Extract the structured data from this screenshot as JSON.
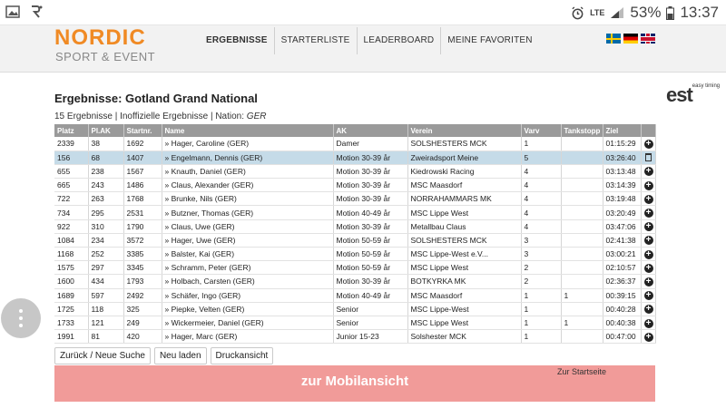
{
  "status_bar": {
    "signal_label": "LTE",
    "battery": "53%",
    "clock": "13:37"
  },
  "site": {
    "logo_main": "NORDIC",
    "logo_sub": "SPORT & EVENT",
    "nav": [
      "ERGEBNISSE",
      "STARTERLISTE",
      "LEADERBOARD",
      "MEINE FAVORITEN"
    ],
    "est_logo": "est",
    "est_logo_tag": "easy timing"
  },
  "page": {
    "title": "Ergebnisse: Gotland Grand National",
    "summary_prefix": "15 Ergebnisse | Inoffizielle Ergebnisse | Nation: ",
    "summary_nation": "GER"
  },
  "table": {
    "columns": [
      "Platz",
      "Pl.AK",
      "Startnr.",
      "Name",
      "AK",
      "Verein",
      "Varv",
      "Tankstopp",
      "Ziel",
      ""
    ],
    "rows": [
      [
        "2339",
        "38",
        "1692",
        "» Hager, Caroline (GER)",
        "Damer",
        "SOLSHESTERS MCK",
        "1",
        "",
        "01:15:29"
      ],
      [
        "156",
        "68",
        "1407",
        "» Engelmann, Dennis (GER)",
        "Motion 30-39 år",
        "Zweiradsport Meine",
        "5",
        "",
        "03:26:40"
      ],
      [
        "655",
        "238",
        "1567",
        "» Knauth, Daniel (GER)",
        "Motion 30-39 år",
        "Kiedrowski Racing",
        "4",
        "",
        "03:13:48"
      ],
      [
        "665",
        "243",
        "1486",
        "» Claus, Alexander (GER)",
        "Motion 30-39 år",
        "MSC Maasdorf",
        "4",
        "",
        "03:14:39"
      ],
      [
        "722",
        "263",
        "1768",
        "» Brunke, Nils (GER)",
        "Motion 30-39 år",
        "NORRAHAMMARS MK",
        "4",
        "",
        "03:19:48"
      ],
      [
        "734",
        "295",
        "2531",
        "» Butzner, Thomas (GER)",
        "Motion 40-49 år",
        "MSC Lippe West",
        "4",
        "",
        "03:20:49"
      ],
      [
        "922",
        "310",
        "1790",
        "» Claus, Uwe (GER)",
        "Motion 30-39 år",
        "Metallbau Claus",
        "4",
        "",
        "03:47:06"
      ],
      [
        "1084",
        "234",
        "3572",
        "» Hager, Uwe (GER)",
        "Motion 50-59 år",
        "SOLSHESTERS MCK",
        "3",
        "",
        "02:41:38"
      ],
      [
        "1168",
        "252",
        "3385",
        "» Balster, Kai (GER)",
        "Motion 50-59 år",
        "MSC Lippe-West e.V...",
        "3",
        "",
        "03:00:21"
      ],
      [
        "1575",
        "297",
        "3345",
        "» Schramm, Peter (GER)",
        "Motion 50-59 år",
        "MSC Lippe West",
        "2",
        "",
        "02:10:57"
      ],
      [
        "1600",
        "434",
        "1793",
        "» Holbach, Carsten (GER)",
        "Motion 30-39 år",
        "BOTKYRKA MK",
        "2",
        "",
        "02:36:37"
      ],
      [
        "1689",
        "597",
        "2492",
        "» Schäfer, Ingo (GER)",
        "Motion 40-49 år",
        "MSC Maasdorf",
        "1",
        "1",
        "00:39:15"
      ],
      [
        "1725",
        "118",
        "325",
        "» Piepke, Velten (GER)",
        "Senior",
        "MSC Lippe-West",
        "1",
        "",
        "00:40:28"
      ],
      [
        "1733",
        "121",
        "249",
        "» Wickermeier, Daniel (GER)",
        "Senior",
        "MSC Lippe West",
        "1",
        "1",
        "00:40:38"
      ],
      [
        "1991",
        "81",
        "420",
        "» Hager, Marc (GER)",
        "Junior 15-23",
        "Solshester MCK",
        "1",
        "",
        "00:47:00"
      ]
    ],
    "row_actions": [
      "add-icon",
      "trash-icon",
      "add-icon",
      "add-icon",
      "add-icon",
      "add-icon",
      "add-icon",
      "add-icon",
      "add-icon",
      "add-icon",
      "add-icon",
      "add-icon",
      "add-icon",
      "add-icon",
      "add-icon"
    ],
    "highlight_row": 1
  },
  "buttons": {
    "back": "Zurück / Neue Suche",
    "reload": "Neu laden",
    "print": "Druckansicht"
  },
  "mobile_bar": {
    "label": "zur Mobilansicht",
    "home_link": "Zur Startseite"
  },
  "colors": {
    "brand_orange": "#f08a24",
    "header_gray": "#9a9a9a",
    "highlight_row": "#c5dbe8",
    "mobile_bar": "#f19b99"
  }
}
